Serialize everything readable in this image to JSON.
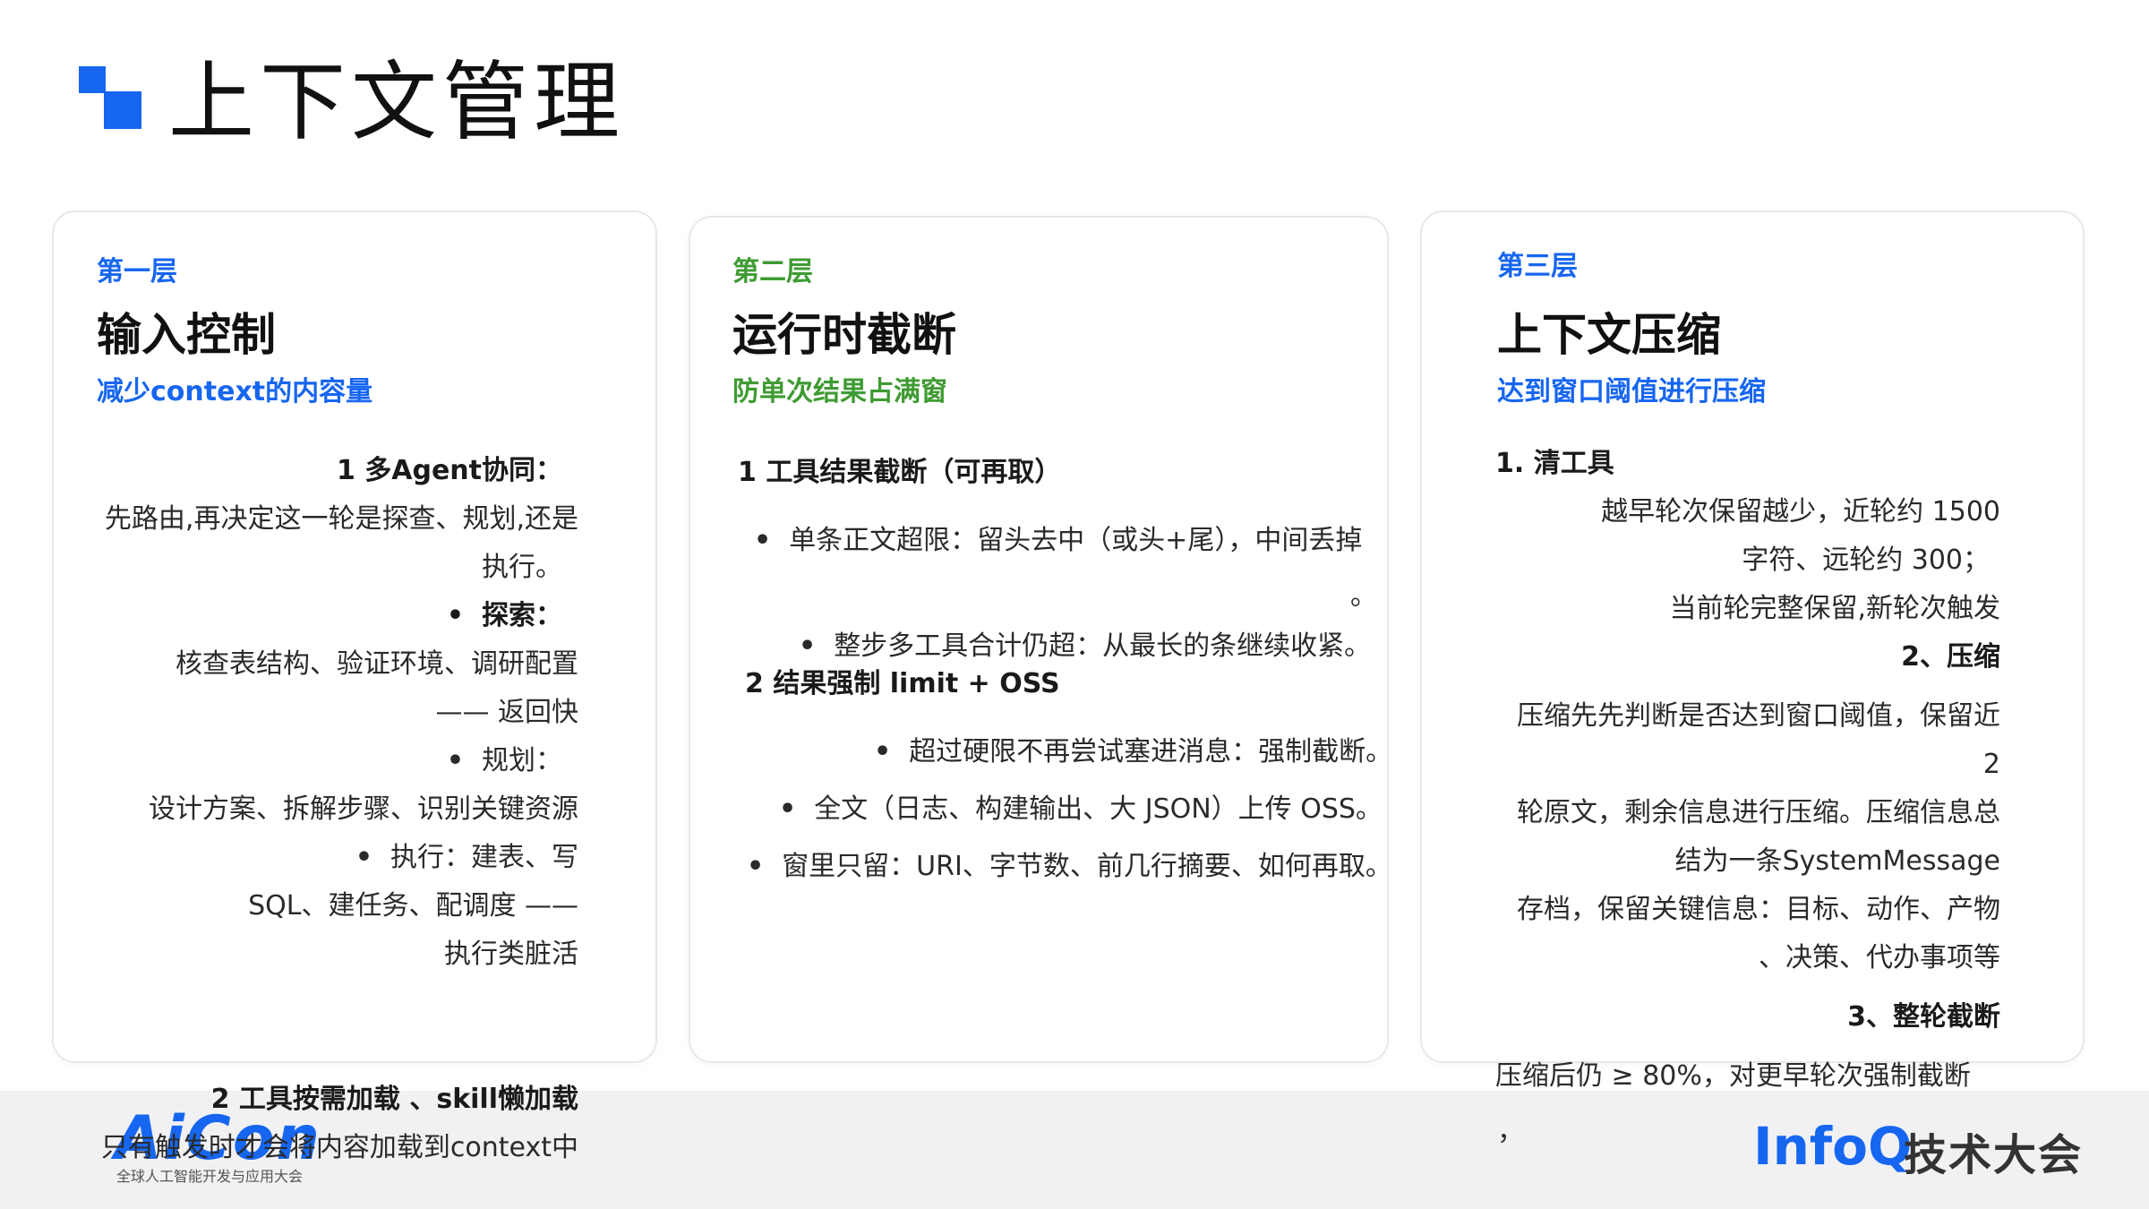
{
  "page": {
    "title": "上下文管理"
  },
  "cards": [
    {
      "label": "第一层",
      "title": "输入控制",
      "subtitle": "减少context的内容量",
      "lines": [
        "1 多Agent协同：",
        "先路由,再决定这一轮是探查、规划,还是",
        "执行。",
        "探索：",
        "核查表结构、验证环境、调研配置",
        "—— 返回快",
        "规划：",
        "设计方案、拆解步骤、识别关键资源",
        "执行：建表、写",
        "SQL、建任务、配调度 ——",
        "执行类脏活",
        "2 工具按需加载 、skill懒加载",
        "只有触发时才会将内容加载到context中"
      ]
    },
    {
      "label": "第二层",
      "title": "运行时截断",
      "subtitle": "防单次结果占满窗",
      "lines": [
        "1  工具结果截断（可再取）",
        "单条正文超限：留头去中（或头+尾），中间丢掉",
        "。",
        "整步多工具合计仍超：从最长的条继续收紧。",
        "2  结果强制 limit + OSS",
        "超过硬限不再尝试塞进消息：强制截断。",
        "全文（日志、构建输出、大 JSON）上传 OSS。",
        "窗里只留：URI、字节数、前几行摘要、如何再取。"
      ]
    },
    {
      "label": "第三层",
      "title": "上下文压缩",
      "subtitle": "达到窗口阈值进行压缩",
      "lines": [
        "1.   清工具",
        "越早轮次保留越少，近轮约 1500",
        "字符、远轮约 300；",
        "当前轮完整保留,新轮次触发",
        "2、压缩",
        "压缩先先判断是否达到窗口阈值，保留近",
        "2",
        "轮原文，剩余信息进行压缩。压缩信息总",
        "结为一条SystemMessage",
        "存档，保留关键信息：目标、动作、产物",
        "、决策、代办事项等",
        "3、整轮截断",
        "压缩后仍 ≥ 80%，对更早轮次强制截断",
        "，"
      ]
    }
  ],
  "bullet_glyph": "•",
  "footer": {
    "left_logo": "AiCon",
    "left_logo_sub": "全球人工智能开发与应用大会",
    "right_logo_brand": "InfoQ",
    "right_logo_text": "技术大会"
  },
  "colors": {
    "accent_blue": "#1766f0",
    "accent_green": "#3f9b33"
  }
}
